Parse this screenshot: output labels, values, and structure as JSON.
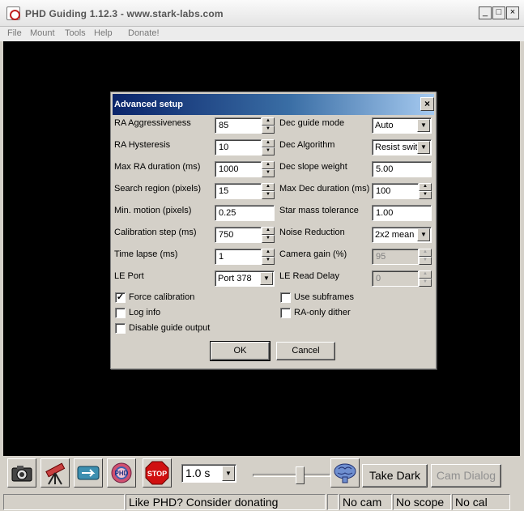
{
  "window": {
    "title": "PHD Guiding 1.12.3  -  www.stark-labs.com",
    "minimize": "_",
    "maximize": "□",
    "close": "×"
  },
  "menu": [
    "File",
    "Mount",
    "Tools",
    "Help",
    "Donate!"
  ],
  "dialog": {
    "title": "Advanced setup",
    "close": "×",
    "left_labels": [
      "RA Aggressiveness",
      "RA Hysteresis",
      "Max RA duration (ms)",
      "Search region (pixels)",
      "Min. motion (pixels)",
      "Calibration step (ms)",
      "Time lapse (ms)",
      "LE Port"
    ],
    "left_values": [
      "85",
      "10",
      "1000",
      "15",
      "0.25",
      "750",
      "1",
      "Port 378"
    ],
    "right_labels": [
      "Dec guide mode",
      "Dec Algorithm",
      "Dec slope weight",
      "Max Dec duration (ms)",
      "Star mass tolerance",
      "Noise Reduction",
      "Camera gain (%)",
      "LE Read Delay"
    ],
    "right_values": [
      "Auto",
      "Resist switch",
      "5.00",
      "100",
      "1.00",
      "2x2 mean",
      "95",
      "0"
    ],
    "checkboxes_left": [
      {
        "label": "Force calibration",
        "checked": true
      },
      {
        "label": "Log info",
        "checked": false
      },
      {
        "label": "Disable guide output",
        "checked": false
      }
    ],
    "checkboxes_right": [
      {
        "label": "Use subframes",
        "checked": false
      },
      {
        "label": "RA-only dither",
        "checked": false
      }
    ],
    "ok": "OK",
    "cancel": "Cancel"
  },
  "toolbar": {
    "icons": [
      "camera-icon",
      "telescope-icon",
      "loop-icon",
      "phd-guide-icon",
      "stop-icon"
    ],
    "stop_label": "STOP",
    "exposure": "1.0 s",
    "gamma_level": 0.62,
    "brain_icon": "brain-icon",
    "take_dark": "Take Dark",
    "cam_dialog": "Cam Dialog"
  },
  "status": {
    "message": "Like PHD? Consider donating",
    "cam": "No cam",
    "scope": "No scope",
    "cal": "No cal"
  }
}
